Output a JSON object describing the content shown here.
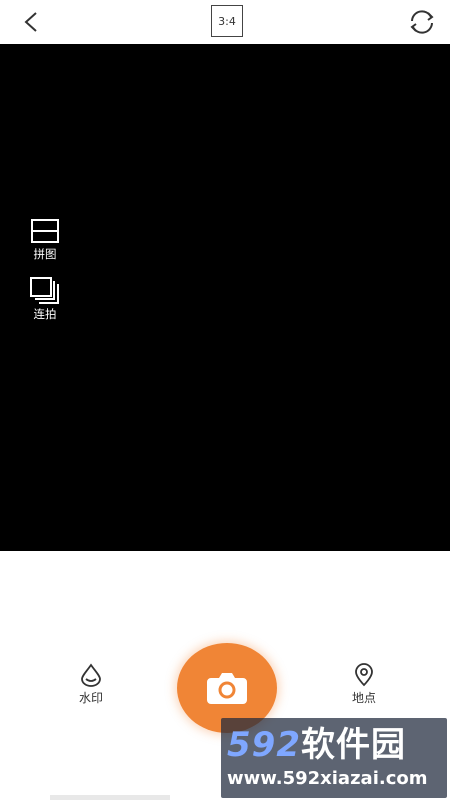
{
  "topbar": {
    "back_icon": "chevron-left-icon",
    "ratio_label": "3:4",
    "switch_icon": "camera-switch-icon"
  },
  "viewfinder": {
    "background": "#000000",
    "tools": [
      {
        "label": "拼图",
        "icon": "collage-icon"
      },
      {
        "label": "连拍",
        "icon": "burst-icon"
      }
    ]
  },
  "bottom": {
    "watermark_label": "水印",
    "location_label": "地点",
    "shutter_icon": "camera-icon",
    "shutter_color": "#f08536"
  },
  "site_watermark": {
    "brand_number": "592",
    "brand_text": "软件园",
    "url": "www.592xiazai.com"
  }
}
